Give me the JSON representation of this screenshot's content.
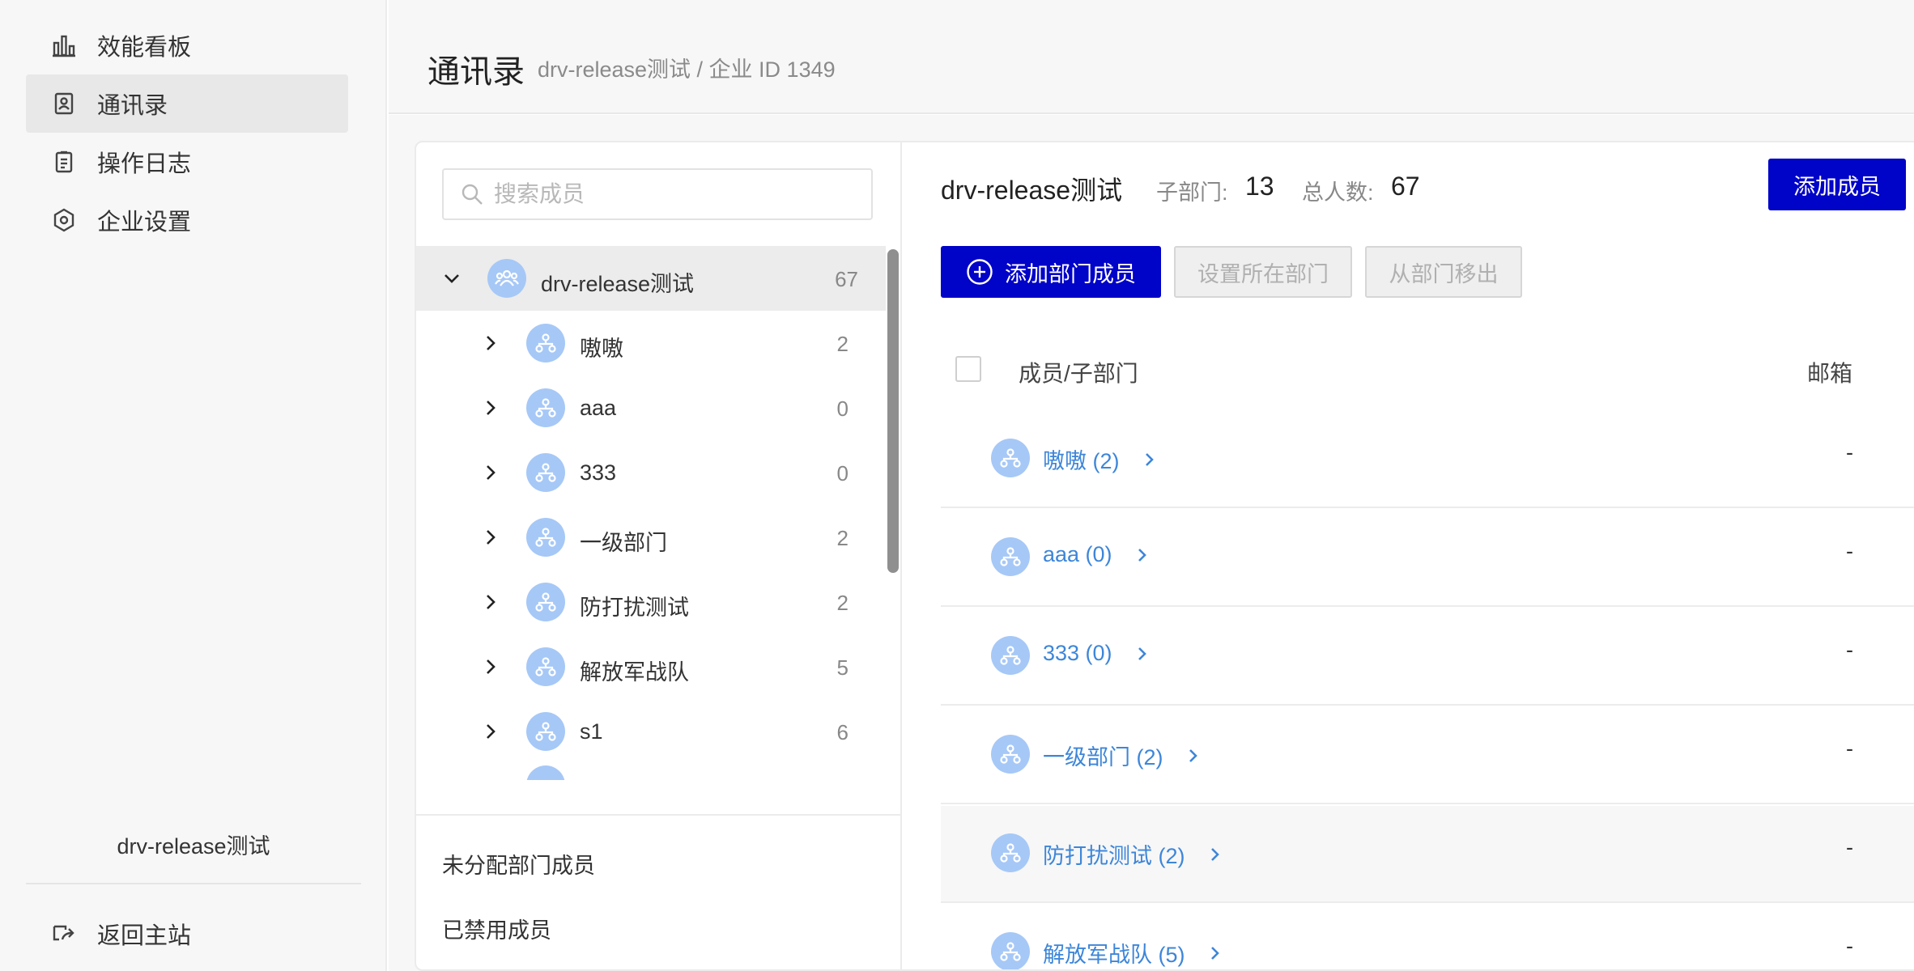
{
  "sidebar": {
    "items": [
      {
        "label": "效能看板",
        "icon": "bar-chart-icon"
      },
      {
        "label": "通讯录",
        "icon": "contacts-icon"
      },
      {
        "label": "操作日志",
        "icon": "clipboard-icon"
      },
      {
        "label": "企业设置",
        "icon": "hexagon-settings-icon"
      }
    ],
    "org_name": "drv-release测试",
    "back_label": "返回主站"
  },
  "header": {
    "title": "通讯录",
    "subtitle": "drv-release测试 / 企业 ID 1349"
  },
  "tree": {
    "search_placeholder": "搜索成员",
    "root": {
      "name": "drv-release测试",
      "count": "67"
    },
    "children": [
      {
        "name": "嗷嗷",
        "count": "2"
      },
      {
        "name": "aaa",
        "count": "0"
      },
      {
        "name": "333",
        "count": "0"
      },
      {
        "name": "一级部门",
        "count": "2"
      },
      {
        "name": "防打扰测试",
        "count": "2"
      },
      {
        "name": "解放军战队",
        "count": "5"
      },
      {
        "name": "s1",
        "count": "6"
      }
    ],
    "unassigned_label": "未分配部门成员",
    "disabled_label": "已禁用成员"
  },
  "detail": {
    "dept_name": "drv-release测试",
    "sub_dept_label": "子部门:",
    "sub_dept_count": "13",
    "total_label": "总人数:",
    "total_count": "67",
    "add_member_label": "添加成员",
    "add_dept_member_label": "添加部门成员",
    "set_dept_label": "设置所在部门",
    "remove_dept_label": "从部门移出",
    "columns": {
      "member": "成员/子部门",
      "email": "邮箱"
    },
    "rows": [
      {
        "label": "嗷嗷 (2)",
        "email": "-"
      },
      {
        "label": "aaa (0)",
        "email": "-"
      },
      {
        "label": "333 (0)",
        "email": "-"
      },
      {
        "label": "一级部门 (2)",
        "email": "-"
      },
      {
        "label": "防打扰测试 (2)",
        "email": "-"
      },
      {
        "label": "解放军战队 (5)",
        "email": "-"
      }
    ]
  },
  "colors": {
    "primary": "#0003c8",
    "link": "#3d86d9",
    "avatar": "#a6c8f7"
  }
}
